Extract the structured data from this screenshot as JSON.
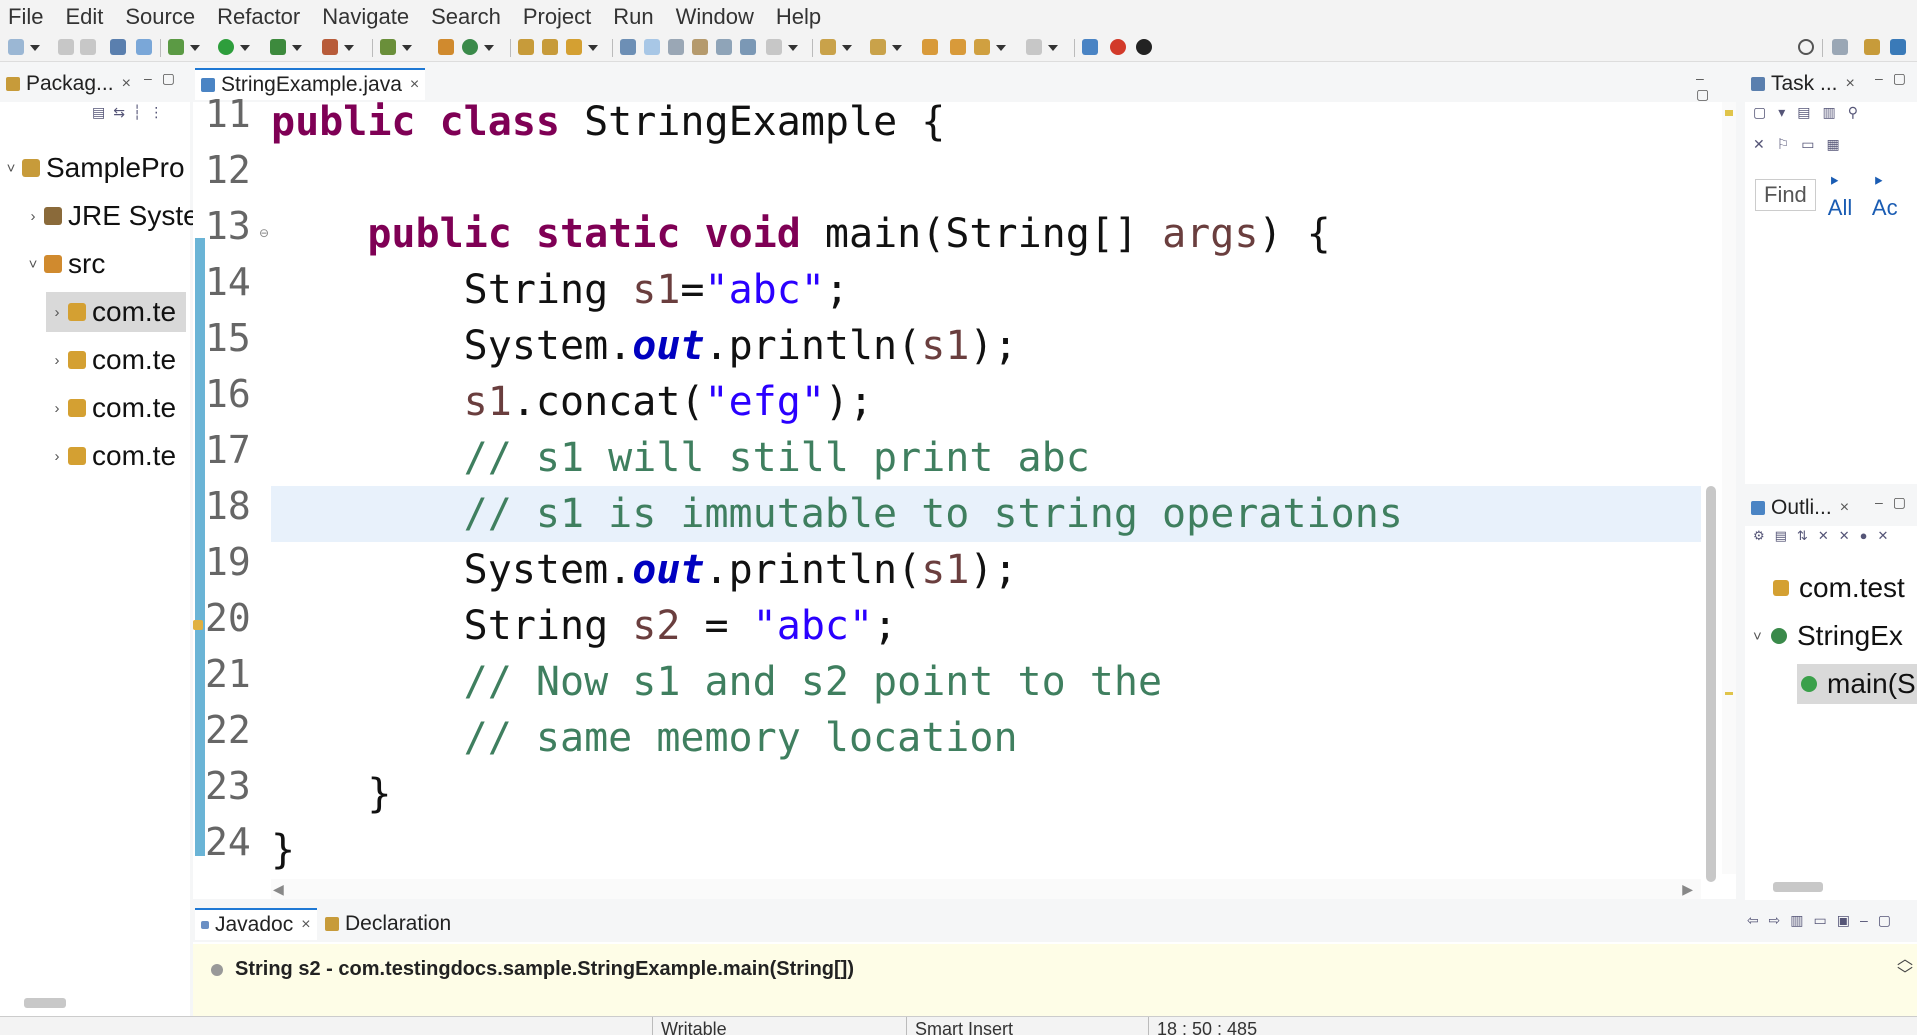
{
  "menu": [
    "File",
    "Edit",
    "Source",
    "Refactor",
    "Navigate",
    "Search",
    "Project",
    "Run",
    "Window",
    "Help"
  ],
  "package_explorer": {
    "tab_label": "Packag...",
    "tree": [
      {
        "label": "SamplePro",
        "arrow": "˅"
      },
      {
        "label": "JRE Syste",
        "arrow": "›"
      },
      {
        "label": "src",
        "arrow": "˅"
      },
      {
        "label": "com.te",
        "arrow": "›"
      },
      {
        "label": "com.te",
        "arrow": "›"
      },
      {
        "label": "com.te",
        "arrow": "›"
      },
      {
        "label": "com.te",
        "arrow": "›"
      }
    ]
  },
  "editor": {
    "tab_label": "StringExample.java",
    "line_numbers": [
      "11",
      "12",
      "13",
      "14",
      "15",
      "16",
      "17",
      "18",
      "19",
      "20",
      "21",
      "22",
      "23",
      "24"
    ]
  },
  "task_list": {
    "tab_label": "Task ...",
    "find_placeholder": "Find",
    "filter_all": "All",
    "filter_active": "Ac"
  },
  "outline": {
    "tab_label": "Outli...",
    "items": [
      "com.test",
      "StringEx",
      "main(S"
    ]
  },
  "bottom": {
    "javadoc_tab": "Javadoc",
    "declaration_tab": "Declaration",
    "signature": "String s2 - com.testingdocs.sample.StringExample.main(String[])"
  },
  "status": {
    "mode": "Writable",
    "insert": "Smart Insert",
    "position": "18 : 50 : 485"
  },
  "colors": {
    "keyword": "#7f0055",
    "string": "#2a00ff",
    "comment": "#3f7f5f",
    "field": "#0000c0",
    "local_variable": "#6a3e3e",
    "current_line": "#e8f1fb",
    "javadoc_bg": "#fefde7"
  }
}
